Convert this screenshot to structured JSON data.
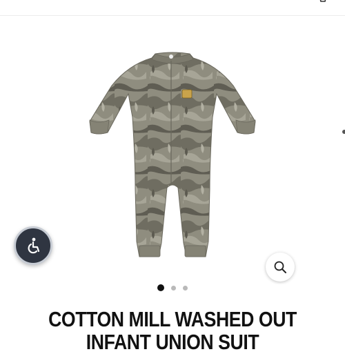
{
  "product": {
    "title": "COTTON MILL WASHED OUT INFANT UNION SUIT",
    "image_alt": "Camo infant union suit"
  },
  "gallery": {
    "slide_count": 3,
    "active_slide": 1
  },
  "icons": {
    "accessibility": "accessibility-icon",
    "zoom": "magnifier-icon",
    "topbar": "bag-icon"
  },
  "colors": {
    "title": "#111111",
    "accessibility_bg": "#2f3541",
    "dot_active": "#111111",
    "dot_inactive": "#b9b9b9"
  }
}
